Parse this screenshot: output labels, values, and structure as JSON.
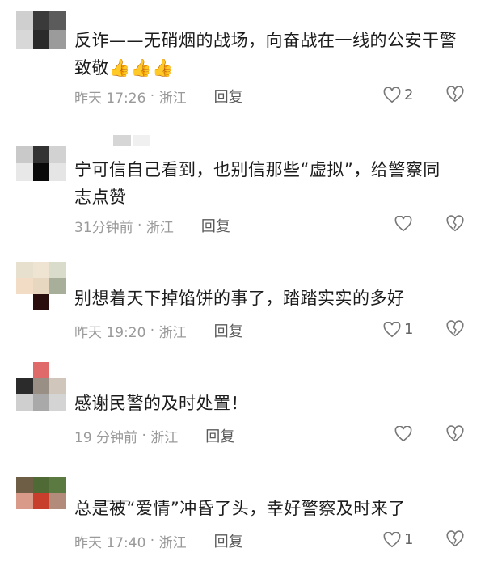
{
  "comments": [
    {
      "text": "反诈——无硝烟的战场，向奋战在一线的公安干警致敬",
      "emoji": "👍👍👍",
      "time": "昨天 17:26",
      "location": "浙江",
      "reply_label": "回复",
      "likes": "2"
    },
    {
      "text": "宁可信自己看到，也别信那些“虚拟”，给警察同志点赞",
      "emoji": "",
      "time": "31分钟前",
      "location": "浙江",
      "reply_label": "回复",
      "likes": ""
    },
    {
      "text": "别想着天下掉馅饼的事了，踏踏实实的多好",
      "emoji": "",
      "time": "昨天 19:20",
      "location": "浙江",
      "reply_label": "回复",
      "likes": "1"
    },
    {
      "text": "感谢民警的及时处置！",
      "emoji": "",
      "time": "19 分钟前",
      "location": "浙江",
      "reply_label": "回复",
      "likes": ""
    },
    {
      "text": "总是被“爱情”冲昏了头，幸好警察及时来了",
      "emoji": "",
      "time": "昨天 17:40",
      "location": "浙江",
      "reply_label": "回复",
      "likes": "1"
    }
  ],
  "icons": {
    "like": "heart-outline-icon",
    "dislike": "broken-heart-icon"
  },
  "colors": {
    "text": "#1c1c1c",
    "meta": "#9a9a9a",
    "reply": "#5a5a5a"
  }
}
